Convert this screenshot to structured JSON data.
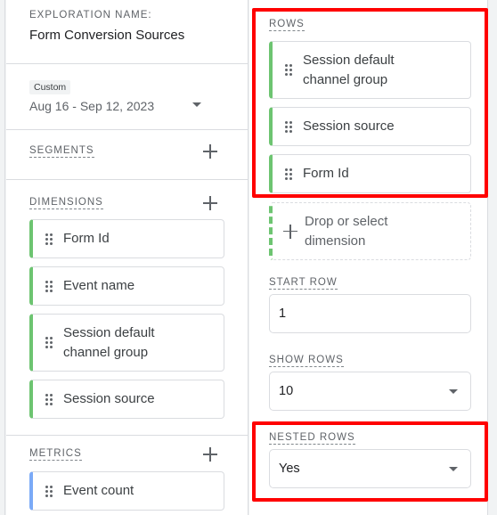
{
  "exploration": {
    "label": "EXPLORATION NAME:",
    "name": "Form Conversion Sources"
  },
  "date": {
    "badge": "Custom",
    "range": "Aug 16 - Sep 12, 2023"
  },
  "segments": {
    "title": "SEGMENTS"
  },
  "dimensions": {
    "title": "DIMENSIONS",
    "items": [
      {
        "label": "Form Id"
      },
      {
        "label": "Event name"
      },
      {
        "label": "Session default channel group"
      },
      {
        "label": "Session source"
      }
    ]
  },
  "metrics": {
    "title": "METRICS",
    "items": [
      {
        "label": "Event count"
      }
    ]
  },
  "rows": {
    "title": "ROWS",
    "items": [
      {
        "label": "Session default channel group"
      },
      {
        "label": "Session source"
      },
      {
        "label": "Form Id"
      }
    ],
    "drop_label": "Drop or select dimension"
  },
  "start_row": {
    "title": "START ROW",
    "value": "1"
  },
  "show_rows": {
    "title": "SHOW ROWS",
    "value": "10"
  },
  "nested_rows": {
    "title": "NESTED ROWS",
    "value": "Yes"
  },
  "colors": {
    "dimension_accent": "#6dc471",
    "metric_accent": "#7baaf7",
    "highlight": "#ff0000"
  }
}
